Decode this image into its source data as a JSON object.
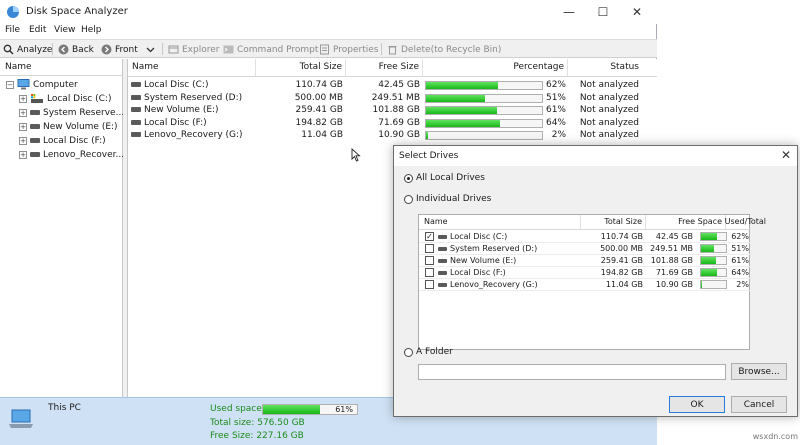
{
  "window": {
    "title": "Disk Space Analyzer",
    "minimize": "—",
    "maximize": "☐",
    "close": "✕"
  },
  "menu": [
    "File",
    "Edit",
    "View",
    "Help"
  ],
  "toolbar": {
    "analyze": "Analyze",
    "back": "Back",
    "front": "Front",
    "explorer": "Explorer",
    "command_prompt": "Command Prompt",
    "properties": "Properties",
    "delete": "Delete(to Recycle Bin)"
  },
  "tree": {
    "header": "Name",
    "root": "Computer",
    "items": [
      "Local Disc (C:)",
      "System Reserve...",
      "New Volume (E:)",
      "Local Disc (F:)",
      "Lenovo_Recover..."
    ]
  },
  "list": {
    "columns": [
      "Name",
      "Total Size",
      "Free Size",
      "Percentage",
      "Status"
    ],
    "rows": [
      {
        "name": "Local Disc (C:)",
        "total": "110.74 GB",
        "free": "42.45 GB",
        "pct": "62%",
        "pct_value": 62,
        "status": "Not analyzed"
      },
      {
        "name": "System Reserved (D:)",
        "total": "500.00 MB",
        "free": "249.51 MB",
        "pct": "51%",
        "pct_value": 51,
        "status": "Not analyzed"
      },
      {
        "name": "New Volume (E:)",
        "total": "259.41 GB",
        "free": "101.88 GB",
        "pct": "61%",
        "pct_value": 61,
        "status": "Not analyzed"
      },
      {
        "name": "Local Disc (F:)",
        "total": "194.82 GB",
        "free": "71.69 GB",
        "pct": "64%",
        "pct_value": 64,
        "status": "Not analyzed"
      },
      {
        "name": "Lenovo_Recovery (G:)",
        "total": "11.04 GB",
        "free": "10.90 GB",
        "pct": "2%",
        "pct_value": 2,
        "status": "Not analyzed"
      }
    ]
  },
  "status": {
    "location": "This PC",
    "used_label": "Used space:",
    "used_pct": "61%",
    "used_value": 61,
    "total": "Total size: 576.50 GB",
    "free": "Free Size: 227.16 GB"
  },
  "dialog": {
    "title": "Select Drives",
    "close": "✕",
    "all_local": "All Local Drives",
    "individual": "Individual Drives",
    "columns": [
      "Name",
      "Total Size",
      "Free Space",
      "Used/Total"
    ],
    "rows": [
      {
        "name": "Local Disc (C:)",
        "total": "110.74 GB",
        "free": "42.45 GB",
        "pct": "62%",
        "pct_value": 62,
        "checked": true
      },
      {
        "name": "System Reserved (D:)",
        "total": "500.00 MB",
        "free": "249.51 MB",
        "pct": "51%",
        "pct_value": 51,
        "checked": false
      },
      {
        "name": "New Volume (E:)",
        "total": "259.41 GB",
        "free": "101.88 GB",
        "pct": "61%",
        "pct_value": 61,
        "checked": false
      },
      {
        "name": "Local Disc (F:)",
        "total": "194.82 GB",
        "free": "71.69 GB",
        "pct": "64%",
        "pct_value": 64,
        "checked": false
      },
      {
        "name": "Lenovo_Recovery (G:)",
        "total": "11.04 GB",
        "free": "10.90 GB",
        "pct": "2%",
        "pct_value": 2,
        "checked": false
      }
    ],
    "folder": "A Folder",
    "folder_value": "",
    "browse": "Browse...",
    "ok": "OK",
    "cancel": "Cancel"
  },
  "watermark": "wsxdn.com",
  "colors": {
    "progress": "#18b818",
    "statusbar": "#cfe2f5",
    "accent": "#2a7bd8"
  }
}
